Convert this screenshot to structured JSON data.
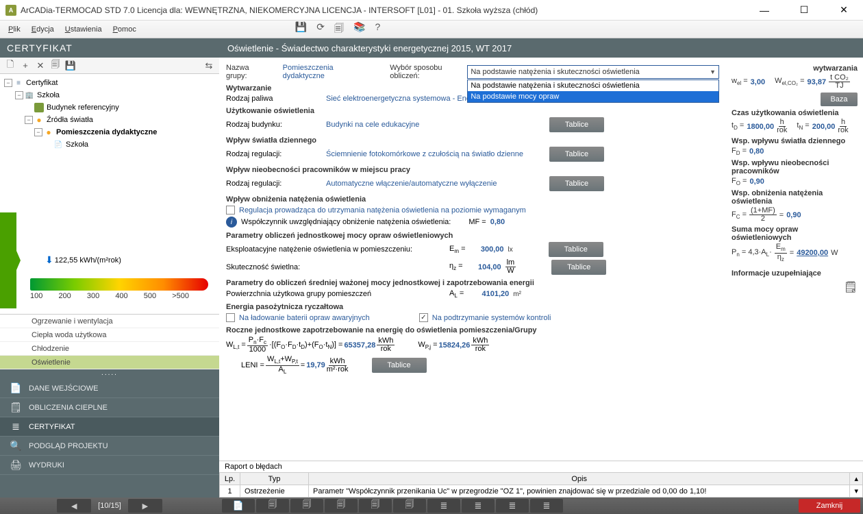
{
  "title": "ArCADia-TERMOCAD STD 7.0 Licencja dla: WEWNĘTRZNA, NIEKOMERCYJNA LICENCJA - INTERSOFT [L01] - 01. Szkoła wyższa (chłód)",
  "menu": {
    "plik": "Plik",
    "edycja": "Edycja",
    "ustawienia": "Ustawienia",
    "pomoc": "Pomoc"
  },
  "cert": {
    "header": "CERTYFIKAT"
  },
  "tree": {
    "cert": "Certyfikat",
    "szkola": "Szkoła",
    "budynek": "Budynek referencyjny",
    "zrodla": "Źródła światła",
    "pom": "Pomieszczenia dydaktyczne",
    "szkola2": "Szkoła"
  },
  "gauge": {
    "value": "122,55 kWh/(m²rok)",
    "ticks": [
      "100",
      "200",
      "300",
      "400",
      "500",
      ">500"
    ]
  },
  "cats": {
    "ogrz": "Ogrzewanie i wentylacja",
    "cwu": "Ciepła woda użytkowa",
    "chlod": "Chłodzenie",
    "osw": "Oświetlenie"
  },
  "nav": {
    "dane": "DANE WEJŚCIOWE",
    "obl": "OBLICZENIA CIEPLNE",
    "cert": "CERTYFIKAT",
    "pod": "PODGLĄD PROJEKTU",
    "wyd": "WYDRUKI"
  },
  "paging": {
    "cur": "[10/15]"
  },
  "content": {
    "hdr": "Oświetlenie - Świadectwo charakterystyki energetycznej 2015, WT 2017",
    "nazwa_lbl": "Nazwa grupy:",
    "nazwa_val": "Pomieszczenia dydaktyczne",
    "wybor_lbl": "Wybór sposobu obliczeń:",
    "select_val": "Na podstawie natężenia i skuteczności oświetlenia",
    "dd1": "Na podstawie natężenia i skuteczności oświetlenia",
    "dd2": "Na podstawie mocy opraw",
    "s_wytw": "Wytwarzanie",
    "rodzaj_pal": "Rodzaj paliwa",
    "pal_val": "Sieć elektroenergetyczna systemowa - Energia elektryczna",
    "s_uzyt": "Użytkowanie oświetlenia",
    "rodzaj_bud": "Rodzaj budynku:",
    "bud_val": "Budynki na cele edukacyjne",
    "s_wplyw": "Wpływ światła dziennego",
    "rodzaj_reg": "Rodzaj regulacji:",
    "reg_val": "Ściemnienie fotokomórkowe z czułością na światło dzienne",
    "s_nieob": "Wpływ nieobecności pracowników w miejscu pracy",
    "reg2_val": "Automatyczne włączenie/automatyczne wyłączenie",
    "s_obn": "Wpływ obniżenia natężenia oświetlenia",
    "chk_reg": "Regulacja prowadząca do utrzymania natężenia oświetlenia na poziomie wymaganym",
    "info_txt": "Współczynnik uwzględniający obniżenie natężenia oświetlenia:",
    "mf_lbl": "MF =",
    "mf_val": "0,80",
    "s_param": "Parametry obliczeń jednostkowej mocy opraw oświetleniowych",
    "ekspl": "Eksploatacyjne natężenie oświetlenia w pomieszczeniu:",
    "em_lbl": "E",
    "em_sub": "m",
    "em_eq": " =",
    "em_val": "300,00",
    "em_unit": "lx",
    "skut": "Skuteczność świetlna:",
    "nz_lbl": "η",
    "nz_sub": "z",
    "nz_eq": " =",
    "nz_val": "104,00",
    "nz_unit_t": "lm",
    "nz_unit_b": "W",
    "s_param2": "Parametry do obliczeń średniej ważonej mocy jednostkowej i zapotrzebowania energii",
    "pow": "Powierzchnia użytkowa grupy pomieszczeń",
    "al_lbl": "A",
    "al_sub": "L",
    "al_eq": " =",
    "al_val": "4101,20",
    "al_unit": "m²",
    "s_ener": "Energia pasożytnicza ryczałtowa",
    "chk_lad": "Na ładowanie baterii opraw awaryjnych",
    "chk_pod": "Na podtrzymanie systemów kontroli",
    "s_rocz": "Roczne jednostkowe zapotrzebowanie na energię do oświetlenia pomieszczenia/Grupy",
    "wlt_val": "65357,28",
    "wpj_lbl": "W",
    "wpj_sub": "P,j",
    "wpj_eq": " =",
    "wpj_val": "15824,26",
    "leni_lbl": "LENI =",
    "leni_val": "19,79",
    "tablice": "Tablice"
  },
  "side": {
    "s_wyt": "wytwarzania",
    "wel": "w",
    "wel_sub": "el",
    "wel_eq": " =",
    "wel_val": "3,00",
    "welco": "W",
    "welco_sub": "el,CO₂",
    "welco_eq": " =",
    "welco_val": "93,87",
    "welco_ut": "t CO₂",
    "welco_ub": "TJ",
    "baza": "Baza",
    "s_czas": "Czas użytkowania oświetlenia",
    "td": "t",
    "td_sub": "D",
    "td_eq": " =",
    "td_val": "1800,00",
    "h_rok_t": "h",
    "h_rok_b": "rok",
    "tn": "t",
    "tn_sub": "N",
    "tn_eq": " =",
    "tn_val": "200,00",
    "s_fd": "Wsp. wpływu światła dziennego",
    "fd_lbl": "F",
    "fd_sub": "D",
    "fd_eq": " =",
    "fd_val": "0,80",
    "s_fo": "Wsp. wpływu nieobecności pracowników",
    "fo_lbl": "F",
    "fo_sub": "O",
    "fo_eq": " =",
    "fo_val": "0,90",
    "s_fc": "Wsp. obniżenia natężenia oświetlenia",
    "fc_lbl": "F",
    "fc_sub": "C",
    "fc_eq": " =",
    "fc_ft": "(1+MF)",
    "fc_fb": "2",
    "fc_eq2": " =",
    "fc_val": "0,90",
    "s_suma": "Suma mocy opraw oświetleniowych",
    "pn_txt": "P",
    "pn_sub": "n",
    "pn_mid": " = 4,3·A",
    "pn_sub2": "L",
    "pn_frac_t": "E",
    "pn_frac_ts": "m",
    "pn_frac_b": "η",
    "pn_frac_bs": "z",
    "pn_eq": " =",
    "pn_val": "49200,00",
    "pn_unit": "W",
    "s_info": "Informacje uzupełniające"
  },
  "err": {
    "title": "Raport o błędach",
    "h_lp": "Lp.",
    "h_typ": "Typ",
    "h_opis": "Opis",
    "r_lp": "1",
    "r_typ": "Ostrzeżenie",
    "r_opis": "Parametr \"Współczynnik przenikania Uc\" w przegrodzie \"OZ 1\", powinien znajdować się w przedziale od 0,00 do 1,10!"
  },
  "bottom": {
    "zamknij": "Zamknij"
  }
}
